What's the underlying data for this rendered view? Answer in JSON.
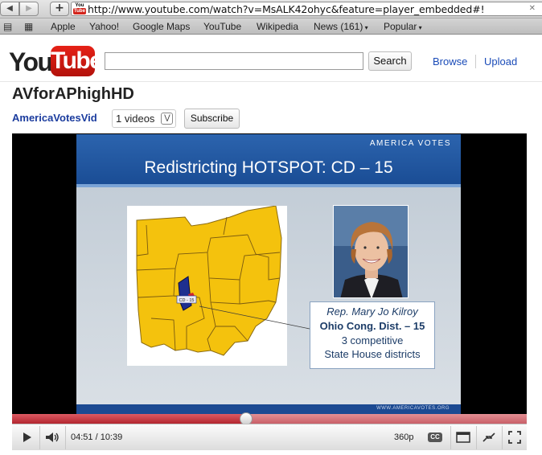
{
  "browser": {
    "url": "http://www.youtube.com/watch?v=MsALK42ohyc&feature=player_embedded#!",
    "favicon_top": "You",
    "favicon_bottom": "Tube",
    "bookmarks": [
      "Apple",
      "Yahoo!",
      "Google Maps",
      "YouTube",
      "Wikipedia",
      "News (161)",
      "Popular"
    ]
  },
  "header": {
    "logo_you": "You",
    "logo_tube": "Tube",
    "search_placeholder": "",
    "search_label": "Search",
    "browse_label": "Browse",
    "upload_label": "Upload"
  },
  "channel": {
    "title": "AVforAPhighHD",
    "name": "AmericaVotesVid",
    "videos": "1 videos",
    "subscribe_label": "Subscribe"
  },
  "slide": {
    "brand": "AMERICA VOTES",
    "title": "Redistricting HOTSPOT: CD – 15",
    "map_label": "CD - 15",
    "caption_line1": "Rep. Mary Jo Kilroy",
    "caption_line2": "Ohio Cong. Dist. – 15",
    "caption_line3": "3 competitive",
    "caption_line4": "State House districts",
    "footer_url": "WWW.AMERICAVOTES.ORG"
  },
  "player": {
    "current_time": "04:51",
    "duration": "10:39",
    "time_display": "04:51 / 10:39",
    "quality": "360p",
    "cc_label": "CC",
    "played_fraction": 0.455,
    "loaded_fraction": 1.0
  },
  "colors": {
    "brand_red": "#cc181e",
    "link_blue": "#1a4bb8",
    "slide_blue": "#1f55a0",
    "map_yellow": "#f5c400"
  }
}
